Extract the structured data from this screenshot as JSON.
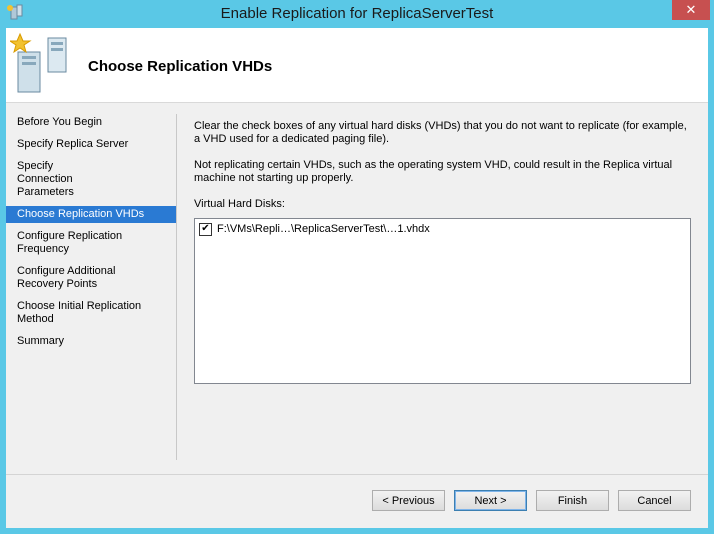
{
  "window": {
    "title": "Enable Replication for ReplicaServerTest",
    "close_label": "✕"
  },
  "header": {
    "title": "Choose Replication VHDs"
  },
  "nav": {
    "items": [
      {
        "label": "Before You Begin",
        "active": false
      },
      {
        "label": "Specify Replica Server",
        "active": false
      },
      {
        "label": "Specify Connection Parameters",
        "active": false
      },
      {
        "label": "Choose Replication VHDs",
        "active": true
      },
      {
        "label": "Configure Replication Frequency",
        "active": false
      },
      {
        "label": "Configure Additional Recovery Points",
        "active": false
      },
      {
        "label": "Choose Initial Replication Method",
        "active": false
      },
      {
        "label": "Summary",
        "active": false
      }
    ]
  },
  "content": {
    "intro": "Clear the check boxes of any virtual hard disks (VHDs) that you do not want to replicate (for example, a VHD used for a dedicated paging file).",
    "warning": "Not replicating certain VHDs, such as the operating system VHD, could result in the Replica virtual machine not starting up properly.",
    "vhd_label": "Virtual Hard Disks:",
    "vhds": [
      {
        "path": "F:\\VMs\\Repli…\\ReplicaServerTest\\…1.vhdx",
        "checked": true
      }
    ]
  },
  "buttons": {
    "previous": "< Previous",
    "next": "Next >",
    "finish": "Finish",
    "cancel": "Cancel"
  },
  "colors": {
    "title_bar": "#5ac8e6",
    "nav_selected": "#2a7ad3",
    "close_button": "#c75050"
  }
}
